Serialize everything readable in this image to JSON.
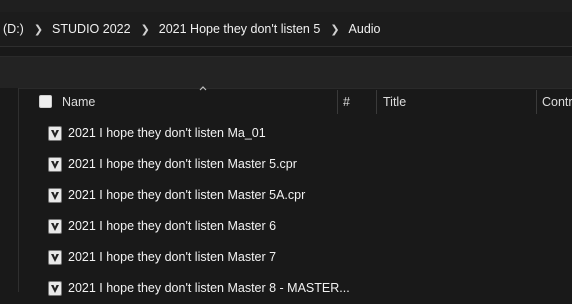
{
  "breadcrumb": {
    "items": [
      "(D:)",
      "STUDIO 2022",
      "2021 Hope they don't listen 5",
      "Audio"
    ]
  },
  "columns": {
    "name": "Name",
    "number": "#",
    "title": "Title",
    "contributing": "Contr"
  },
  "files": [
    "2021 I hope they don't listen Ma_01",
    "2021 I hope they don't listen Master 5.cpr",
    "2021 I hope they don't listen Master 5A.cpr",
    "2021 I hope they don't listen Master 6",
    "2021 I hope they don't listen Master 7",
    "2021 I hope they don't listen Master 8 - MASTER..."
  ],
  "icons": {
    "chevron": "chevron-right-icon",
    "sort": "sort-up-icon",
    "file": "cubase-project-file-icon"
  }
}
